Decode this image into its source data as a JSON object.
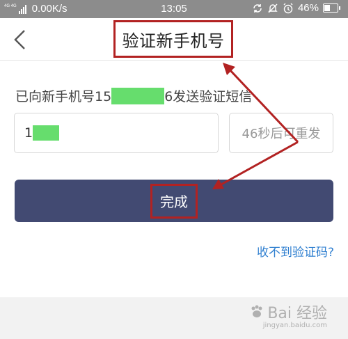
{
  "status_bar": {
    "network_label": "4G 4G",
    "net_speed": "0.00K/s",
    "time": "13:05",
    "battery_percent": "46%",
    "battery_level": 0.46,
    "icons": [
      "signal-icon",
      "sync-icon",
      "mute-icon",
      "alarm-icon",
      "battery-icon"
    ]
  },
  "header": {
    "title": "验证新手机号",
    "back_icon": "chevron-left-icon"
  },
  "main": {
    "sent_prefix": "已向新手机号15",
    "sent_suffix": "6发送验证短信",
    "code_input_value": "1",
    "resend_label": "46秒后可重发",
    "done_label": "完成",
    "no_code_link": "收不到验证码?"
  },
  "watermark": {
    "text": "Bai 经验",
    "sub": "jingyan.baidu.com"
  },
  "colors": {
    "primary_button": "#424a72",
    "link": "#2f7fd0",
    "annotation": "#b22222",
    "redaction": "#66dd6d",
    "status_bar": "#8c8c8c"
  }
}
